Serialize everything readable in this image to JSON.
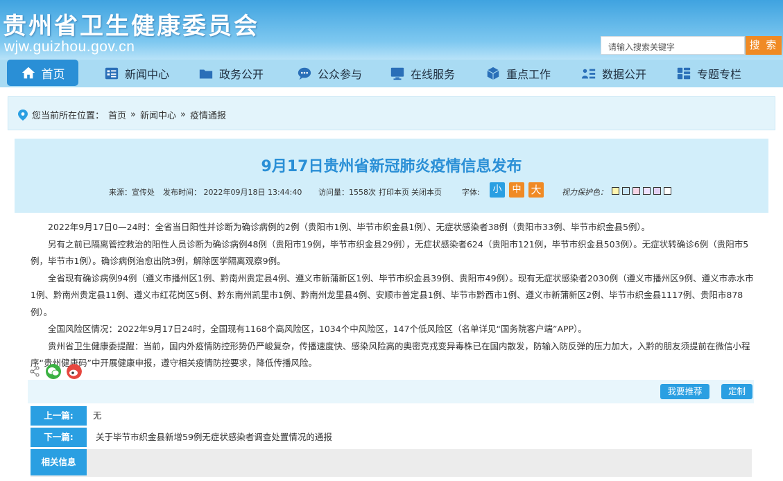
{
  "header": {
    "site_title": "贵州省卫生健康委员会",
    "site_url": "wjw.guizhou.gov.cn",
    "search_placeholder": "请输入搜索关键字",
    "search_button": "搜 索"
  },
  "nav": {
    "items": [
      {
        "label": "首页",
        "icon": "home-icon"
      },
      {
        "label": "新闻中心",
        "icon": "news-list-icon"
      },
      {
        "label": "政务公开",
        "icon": "folder-icon"
      },
      {
        "label": "公众参与",
        "icon": "chat-bubble-icon"
      },
      {
        "label": "在线服务",
        "icon": "monitor-icon"
      },
      {
        "label": "重点工作",
        "icon": "cube-icon"
      },
      {
        "label": "数据公开",
        "icon": "data-list-icon"
      },
      {
        "label": "专题专栏",
        "icon": "grid-icon"
      }
    ]
  },
  "breadcrumb": {
    "prefix": "您当前所在位置：",
    "home": "首页",
    "sep": "»",
    "section": "新闻中心",
    "current": "疫情通报"
  },
  "article": {
    "title": "9月17日贵州省新冠肺炎疫情信息发布",
    "source": "来源：宣传处",
    "date": "发布时间： 2022年09月18日 13:44:40",
    "views": "访问量：1558次",
    "print": "打印本页",
    "close": "关闭本页",
    "font_label": "字体:",
    "font_small": "小",
    "font_medium": "中",
    "font_large": "大",
    "eye_label": "视力保护色：",
    "swatch_colors": [
      "#fff6b0",
      "#c8e6f8",
      "#f7d6e6",
      "#efe2ff",
      "#e2d0f2",
      "#ffffff"
    ],
    "paragraphs": [
      "2022年9月17日0—24时：全省当日阳性并诊断为确诊病例的2例（贵阳市1例、毕节市织金县1例）、无症状感染者38例（贵阳市33例、毕节市织金县5例）。",
      "另有之前已隔离管控救治的阳性人员诊断为确诊病例48例（贵阳市19例，毕节市织金县29例），无症状感染者624（贵阳市121例，毕节市织金县503例）。无症状转确诊6例（贵阳市5例，毕节市1例）。确诊病例治愈出院3例，解除医学隔离观察9例。",
      "全省现有确诊病例94例（遵义市播州区1例、黔南州贵定县4例、遵义市新蒲新区1例、毕节市织金县39例、贵阳市49例）。现有无症状感染者2030例（遵义市播州区9例、遵义市赤水市1例、黔南州贵定县11例、遵义市红花岗区5例、黔东南州凯里市1例、黔南州龙里县4例、安顺市普定县1例、毕节市黔西市1例、遵义市新蒲新区2例、毕节市织金县1117例、贵阳市878例）。",
      "全国风险区情况：2022年9月17日24时，全国现有1168个高风险区，1034个中风险区，147个低风险区（名单详见“国务院客户端”APP）。",
      "贵州省卫生健康委提醒：当前，国内外疫情防控形势仍严峻复杂，传播速度快、感染风险高的奥密克戎变异毒株已在国内散发，防输入防反弹的压力加大，入黔的朋友须提前在微信小程序“贵州健康码”中开展健康申报，遵守相关疫情防控要求，降低传播风险。"
    ]
  },
  "actions": {
    "recommend": "我要推荐",
    "subscribe": "定制"
  },
  "pager": {
    "prev_label": "上一篇:",
    "prev_value": "无",
    "next_label": "下一篇:",
    "next_value": "关于毕节市织金县新增59例无症状感染者调查处置情况的通报",
    "related_label": "相关信息"
  },
  "colors": {
    "primary": "#2a8fd6",
    "accent": "#f08a24",
    "nav_bg": "#a9dbf3"
  }
}
